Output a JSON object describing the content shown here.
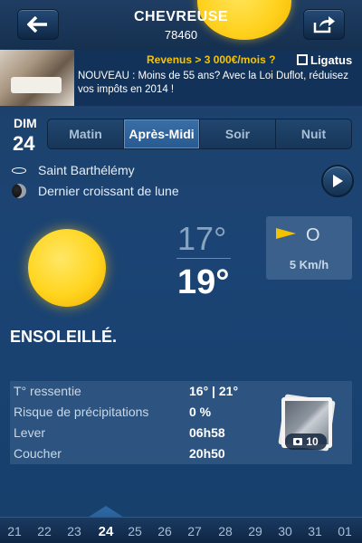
{
  "header": {
    "city": "CHEVREUSE",
    "zip": "78460",
    "back_icon": "arrow-left-icon",
    "share_icon": "share-icon"
  },
  "ad": {
    "title": "Revenus > 3 000€/mois ?",
    "logo": "Ligatus",
    "text": "NOUVEAU : Moins de 55 ans? Avec la Loi Duflot, réduisez vos impôts en 2014 !"
  },
  "day": {
    "name": "DIM",
    "number": "24"
  },
  "tabs": [
    {
      "label": "Matin",
      "active": false
    },
    {
      "label": "Après-Midi",
      "active": true
    },
    {
      "label": "Soir",
      "active": false
    },
    {
      "label": "Nuit",
      "active": false
    }
  ],
  "saint": "Saint Barthélémy",
  "moon_phase": "Dernier croissant de lune",
  "weather": {
    "temp_min": "17°",
    "temp_max": "19°",
    "wind_direction": "O",
    "wind_speed": "5 Km/h",
    "condition": "ENSOLEILLÉ.",
    "icon": "sun-icon"
  },
  "details": [
    {
      "label": "T° ressentie",
      "value": "16° | 21°"
    },
    {
      "label": "Risque de précipitations",
      "value": "0 %"
    },
    {
      "label": "Lever",
      "value": "06h58"
    },
    {
      "label": "Coucher",
      "value": "20h50"
    }
  ],
  "photos": {
    "count": "10"
  },
  "dates": [
    "21",
    "22",
    "23",
    "24",
    "25",
    "26",
    "27",
    "28",
    "29",
    "30",
    "31",
    "01"
  ],
  "selected_date": "24",
  "colors": {
    "accent_yellow": "#f5c400",
    "background": "#1b4474",
    "active_tab": "#2f6aa5"
  }
}
